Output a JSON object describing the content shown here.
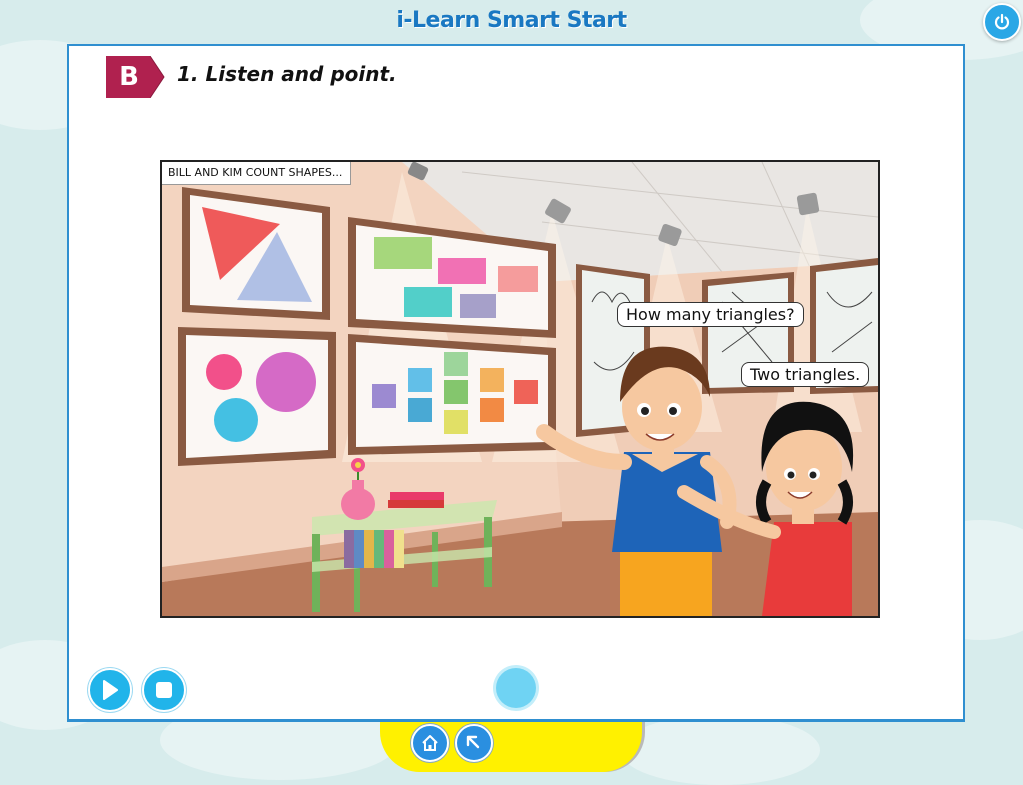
{
  "app": {
    "title": "i-Learn Smart Start"
  },
  "section": {
    "badge": "B",
    "instruction": "1. Listen and point."
  },
  "scene": {
    "caption": "BILL AND KIM COUNT SHAPES...",
    "bubble_boy": "How many triangles?",
    "bubble_girl": "Two triangles."
  },
  "controls": {
    "play_icon": "play-icon",
    "stop_icon": "stop-icon",
    "home_icon": "home-icon",
    "back_icon": "back-arrow-icon",
    "power_icon": "power-icon"
  },
  "colors": {
    "accent": "#21b4ea",
    "badge": "#b0214f",
    "title": "#1a78c2",
    "bottom_bar": "#fff100"
  }
}
